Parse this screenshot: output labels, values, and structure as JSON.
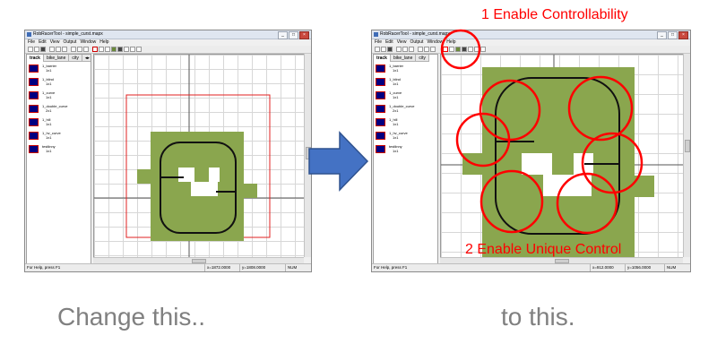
{
  "left_window": {
    "title": "RobRacerTool - simple_curst.mapx",
    "menu": [
      "File",
      "Edit",
      "View",
      "Output",
      "Window",
      "Help"
    ],
    "tabs": [
      "track",
      "bike_lane",
      "city"
    ],
    "tiles": [
      {
        "name": "1_barrier",
        "size": "1x1"
      },
      {
        "name": "1_blind",
        "size": "1x1"
      },
      {
        "name": "1_curve",
        "size": "1x1"
      },
      {
        "name": "1_double_curve",
        "size": "2x1"
      },
      {
        "name": "1_hill",
        "size": "1x1"
      },
      {
        "name": "1_hv_curve",
        "size": "1x1"
      },
      {
        "name": "testlinny",
        "size": "1x1"
      }
    ],
    "status": {
      "help": "For Help, press F1",
      "x": "x=1872.0000",
      "y": "y=1808.0000",
      "flag": "NUM"
    }
  },
  "right_window": {
    "title": "RobRacerTool - simple_curst.mapx",
    "menu": [
      "File",
      "Edit",
      "View",
      "Output",
      "Window",
      "Help"
    ],
    "tabs": [
      "track",
      "bike_lane",
      "city"
    ],
    "tiles": [
      {
        "name": "1_barrier",
        "size": "1x1"
      },
      {
        "name": "1_blind",
        "size": "1x1"
      },
      {
        "name": "1_curve",
        "size": "1x1"
      },
      {
        "name": "1_double_curve",
        "size": "2x1"
      },
      {
        "name": "1_hill",
        "size": "1x1"
      },
      {
        "name": "1_hv_curve",
        "size": "1x1"
      },
      {
        "name": "testlinny",
        "size": "1x1"
      }
    ],
    "status": {
      "help": "For Help, press F1",
      "x": "x=912.0000",
      "y": "y=1056.0000",
      "flag": "NUM"
    }
  },
  "annotations": {
    "controllability": "1 Enable Controllability",
    "unique_control": "2 Enable Unique Control"
  },
  "captions": {
    "before": "Change this..",
    "after": "to this."
  },
  "colors": {
    "track_green": "#8aa64e",
    "annotation_red": "#ff0000",
    "arrow_blue": "#4472c4",
    "caption_gray": "#808080"
  }
}
